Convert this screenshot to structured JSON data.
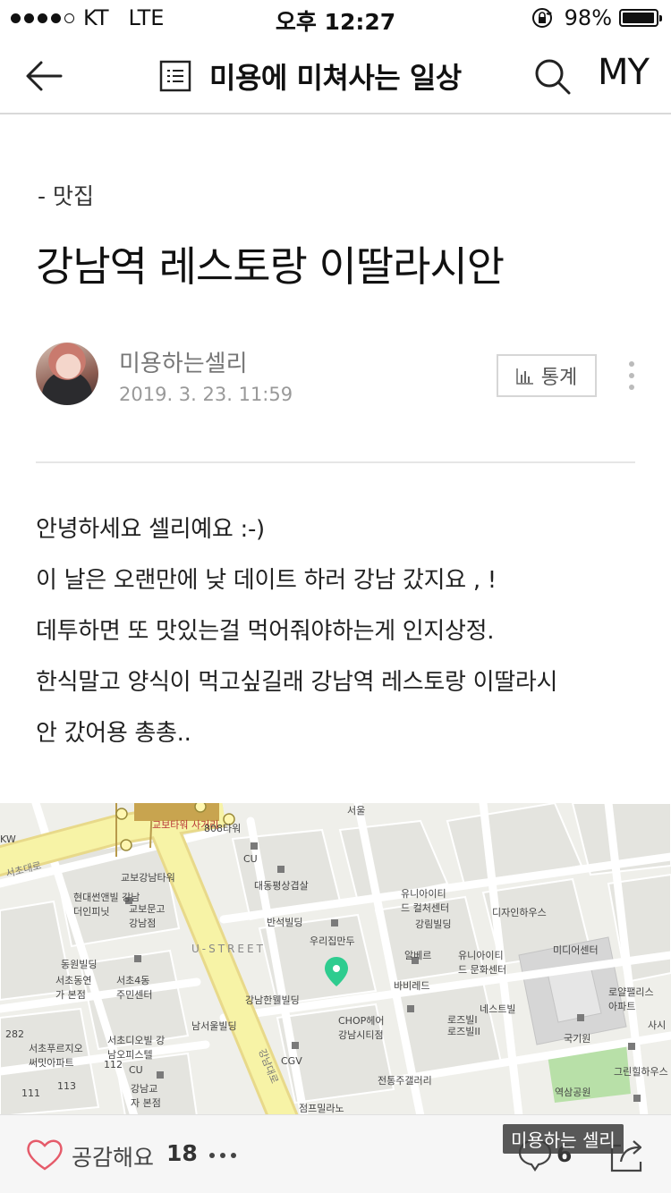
{
  "status_bar": {
    "carrier": "KT",
    "network": "LTE",
    "time": "오후 12:27",
    "battery": "98%",
    "battery_level": 0.98
  },
  "nav": {
    "title": "미용에 미쳐사는 일상",
    "my_label": "MY",
    "icons": [
      "back-arrow-icon",
      "list-icon",
      "search-icon"
    ]
  },
  "post": {
    "category": "- 맛집",
    "title": "강남역 레스토랑 이딸라시안",
    "author": "미용하는셀리",
    "date": "2019. 3. 23. 11:59",
    "stats_label": "통계",
    "body_lines": [
      "안녕하세요 셀리예요 :-)",
      "이 날은 오랜만에 낮 데이트 하러 강남 갔지요 , !",
      "데투하면 또 맛있는걸 먹어줘야하는게 인지상정.",
      "한식말고 양식이 먹고싶길래 강남역 레스토랑 이딸라시",
      "안 갔어용 총총.."
    ]
  },
  "map": {
    "labels": [
      "교보타워 사거리",
      "808타워",
      "CU",
      "교보강남타워",
      "대동평상겹살",
      "현대썬앤빌 강남더인피닛",
      "교보문고 강남점",
      "반석빌딩",
      "유니아이티드 컬처센터",
      "강림빌딩",
      "디자인하우스",
      "U-STREET",
      "우리집만두",
      "알베르",
      "유니아이티드 문화센터",
      "미디어센터",
      "동원빌딩",
      "서초동연가 본점",
      "서초4동 주민센터",
      "바비레드",
      "강남한웰빌딩",
      "네스트빌",
      "로즈빌I",
      "로즈빌II",
      "로얄팰리스 아파트",
      "남서울빌딩",
      "CHOP헤어 강남시티점",
      "국기원",
      "서초푸르지오 써밋아파트",
      "서초디오빌 강남오피스텔",
      "CGV",
      "그린힐하우스",
      "CU",
      "강남교자 본점",
      "전통주갤러리",
      "역삼공원",
      "점프밀라노",
      "강남대로",
      "서초대로",
      "서울",
      "KW",
      "사시",
      "282",
      "112",
      "113",
      "111"
    ],
    "accent_marker": "#2ecc8f",
    "park_color": "#b8e0a8",
    "main_road_color": "#f5f0a0"
  },
  "bottom": {
    "like_label": "공감해요",
    "like_count": "18",
    "comment_count": "6",
    "watermark": "미용하는 셀리"
  }
}
